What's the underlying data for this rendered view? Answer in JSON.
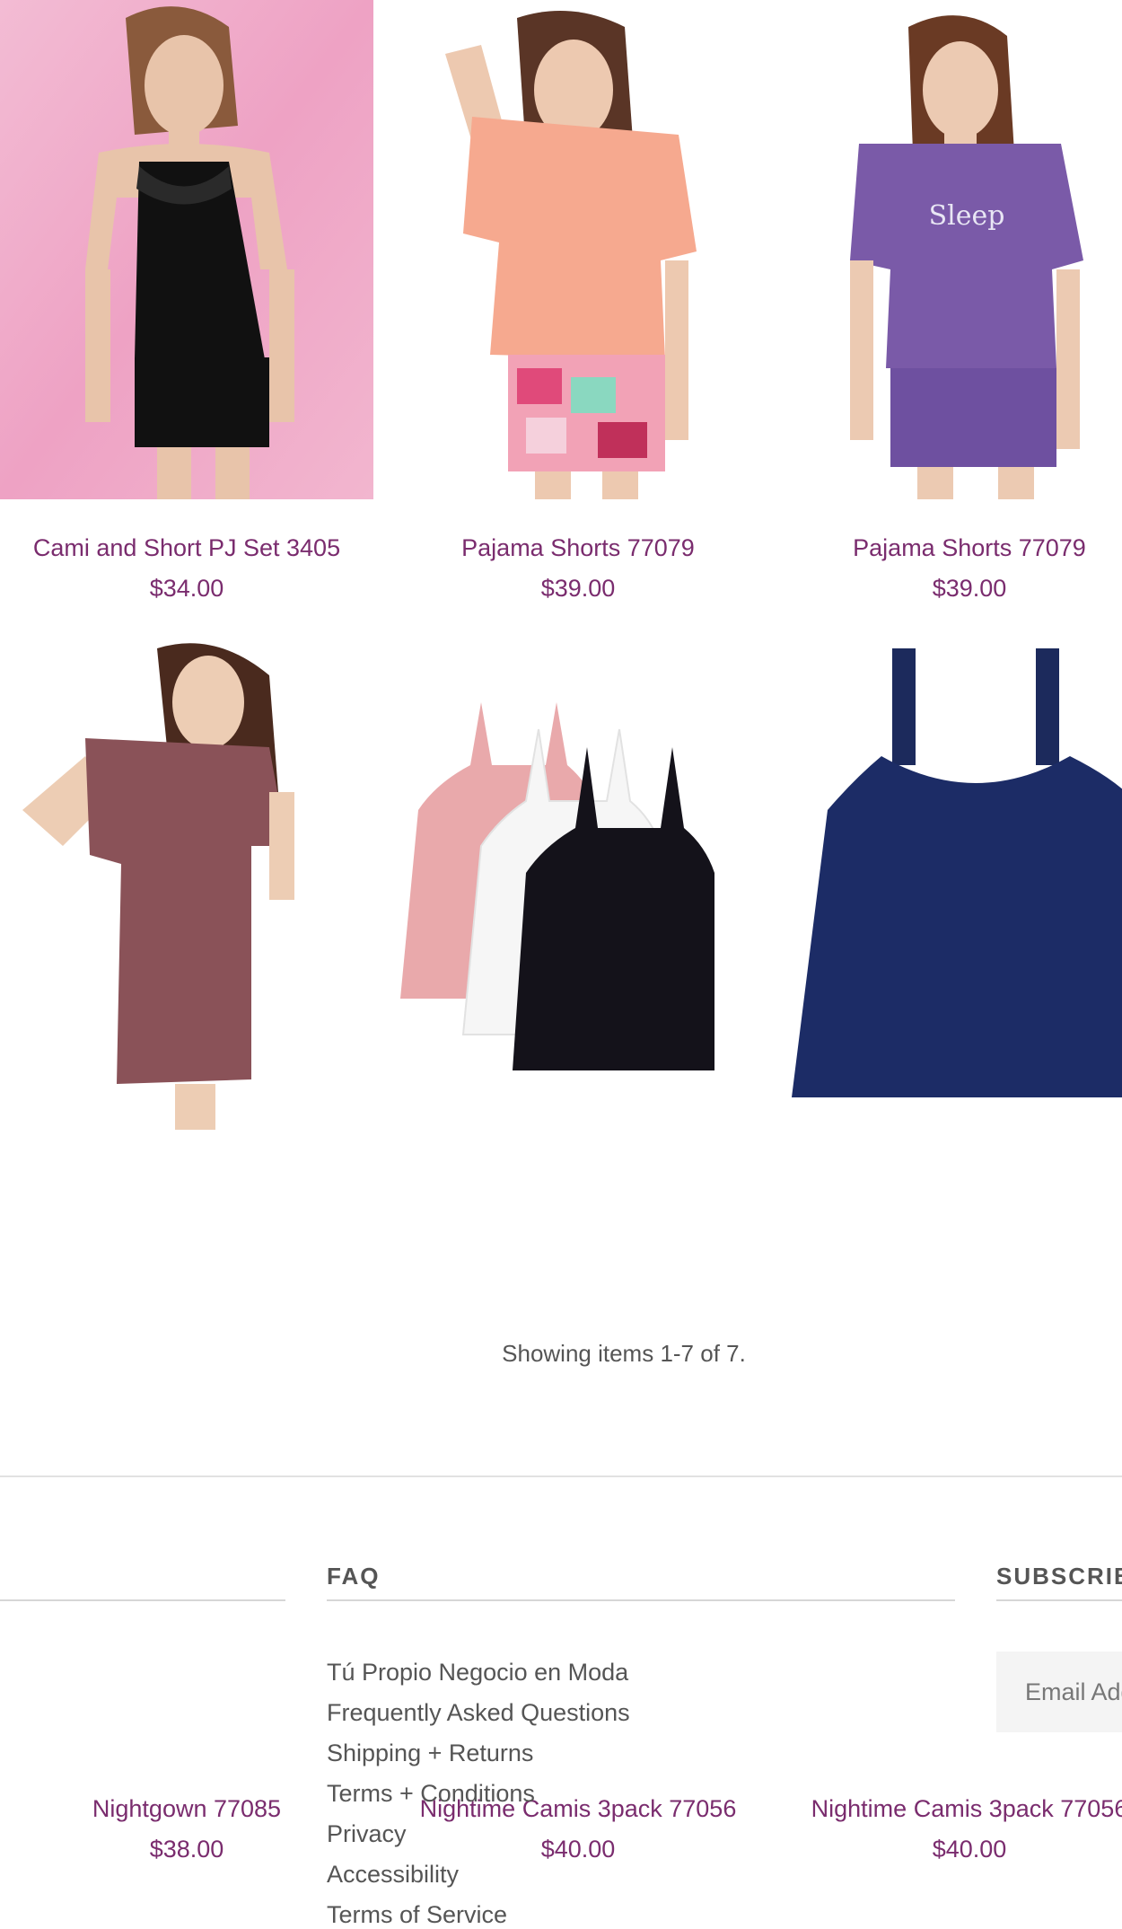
{
  "products": [
    {
      "title": "Cami and Short PJ Set 3405",
      "price": "$34.00"
    },
    {
      "title": "Pajama Shorts 77079",
      "price": "$39.00"
    },
    {
      "title": "Pajama Shorts 77079",
      "price": "$39.00"
    },
    {
      "title": "Nightgown 77085",
      "price": "$38.00"
    },
    {
      "title": "Nightime Camis 3pack 77056",
      "price": "$40.00"
    },
    {
      "title": "Nightime Camis 3pack 77056",
      "price": "$40.00"
    }
  ],
  "pagination": {
    "showing": "Showing items 1-7 of 7."
  },
  "footer": {
    "faq_heading": "FAQ",
    "subscribe_heading": "SUBSCRIBE",
    "links": [
      "Tú Propio Negocio en Moda",
      "Frequently Asked Questions",
      "Shipping + Returns",
      "Terms + Conditions",
      "Privacy",
      "Accessibility",
      "Terms of Service"
    ],
    "email_placeholder": "Email Address"
  },
  "colors": {
    "link": "#7a2c6e",
    "text": "#555555",
    "rule": "#e2e2e2"
  }
}
